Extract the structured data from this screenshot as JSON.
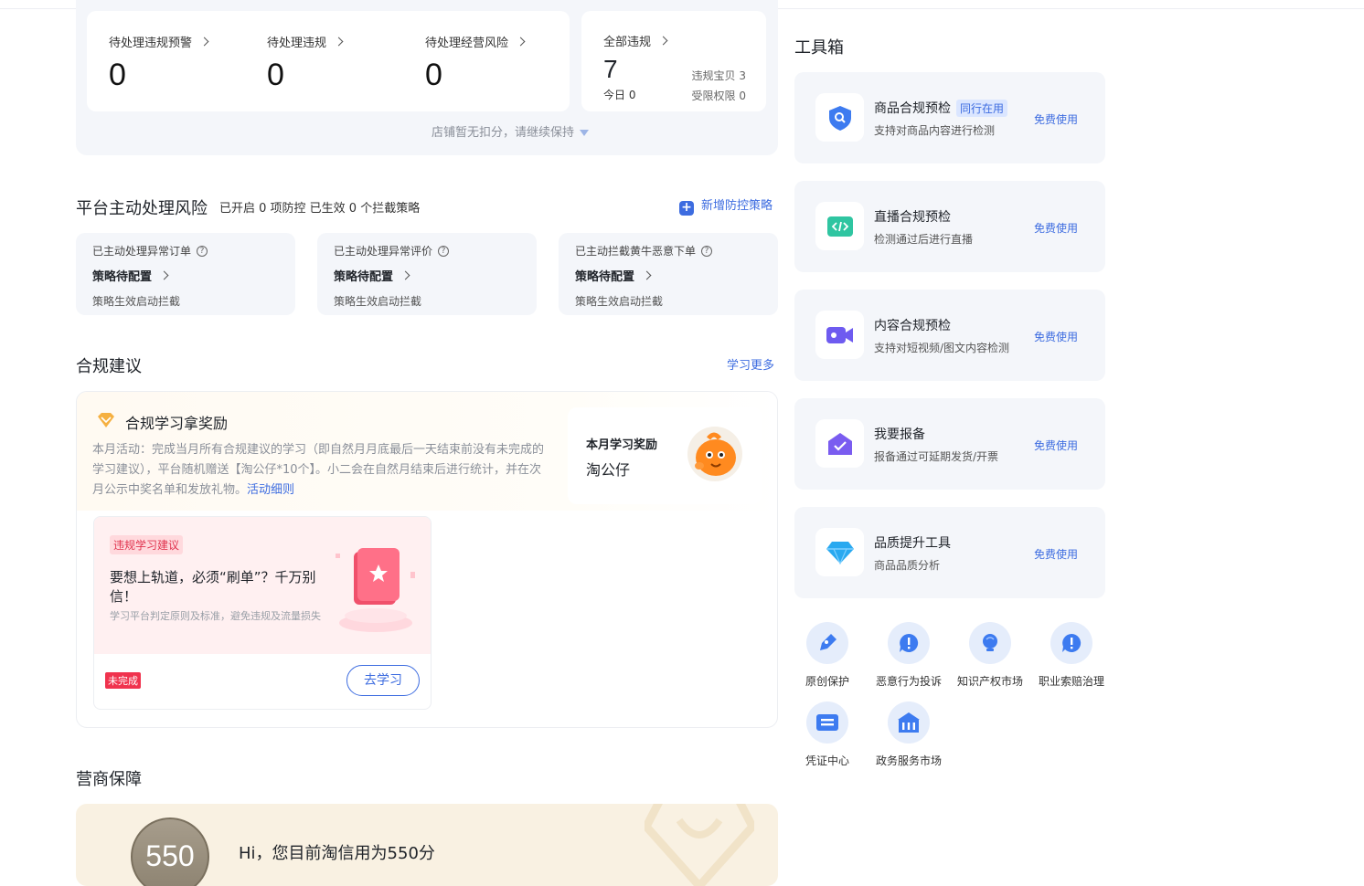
{
  "summary": {
    "metrics": [
      {
        "label": "待处理违规预警",
        "value": "0"
      },
      {
        "label": "待处理违规",
        "value": "0"
      },
      {
        "label": "待处理经营风险",
        "value": "0"
      }
    ],
    "all_violations": {
      "label": "全部违规",
      "value": "7",
      "today": "今日 0",
      "item_violations": "违规宝贝 3",
      "restricted_permissions": "受限权限 0"
    },
    "hint": "店铺暂无扣分，请继续保持"
  },
  "platform_risk": {
    "title": "平台主动处理风险",
    "subtitle": "已开启 0 项防控 已生效 0 个拦截策略",
    "add_link": "新增防控策略",
    "cards": [
      {
        "title": "已主动处理异常订单",
        "status": "策略待配置",
        "desc": "策略生效启动拦截"
      },
      {
        "title": "已主动处理异常评价",
        "status": "策略待配置",
        "desc": "策略生效启动拦截"
      },
      {
        "title": "已主动拦截黄牛恶意下单",
        "status": "策略待配置",
        "desc": "策略生效启动拦截"
      }
    ]
  },
  "compliance": {
    "title": "合规建议",
    "learn_more": "学习更多",
    "reward_title": "合规学习拿奖励",
    "reward_text": "本月活动：完成当月所有合规建议的学习（即自然月月底最后一天结束前没有未完成的学习建议），平台随机赠送【淘公仔*10个】。小二会在自然月结束后进行统计，并在次月公示中奖名单和发放礼物。",
    "reward_link": "活动细则",
    "monthly_reward_label": "本月学习奖励",
    "monthly_reward_value": "淘公仔",
    "lesson": {
      "tag": "违规学习建议",
      "title": "要想上轨道，必须“刷单”？千万别信！",
      "desc": "学习平台判定原则及标准，避免违规及流量损失",
      "status": "未完成",
      "button": "去学习"
    }
  },
  "merchant_guarantee": {
    "title": "营商保障",
    "score": "550",
    "text": "Hi，您目前淘信用为550分"
  },
  "toolbox": {
    "title": "工具箱",
    "tools": [
      {
        "name": "商品合规预检",
        "tag": "同行在用",
        "desc": "支持对商品内容进行检测",
        "action": "免费使用",
        "icon": "shield-search-icon"
      },
      {
        "name": "直播合规预检",
        "tag": "",
        "desc": "检测通过后进行直播",
        "action": "免费使用",
        "icon": "code-icon"
      },
      {
        "name": "内容合规预检",
        "tag": "",
        "desc": "支持对短视频/图文内容检测",
        "action": "免费使用",
        "icon": "video-icon"
      },
      {
        "name": "我要报备",
        "tag": "",
        "desc": "报备通过可延期发货/开票",
        "action": "免费使用",
        "icon": "home-check-icon"
      },
      {
        "name": "品质提升工具",
        "tag": "",
        "desc": "商品品质分析",
        "action": "免费使用",
        "icon": "diamond-icon"
      }
    ],
    "quick_links": [
      {
        "label": "原创保护",
        "icon": "pen-icon"
      },
      {
        "label": "恶意行为投诉",
        "icon": "alert-icon"
      },
      {
        "label": "知识产权市场",
        "icon": "bulb-icon"
      },
      {
        "label": "职业索赔治理",
        "icon": "alert-icon"
      },
      {
        "label": "凭证中心",
        "icon": "voucher-icon"
      },
      {
        "label": "政务服务市场",
        "icon": "government-icon"
      }
    ]
  }
}
